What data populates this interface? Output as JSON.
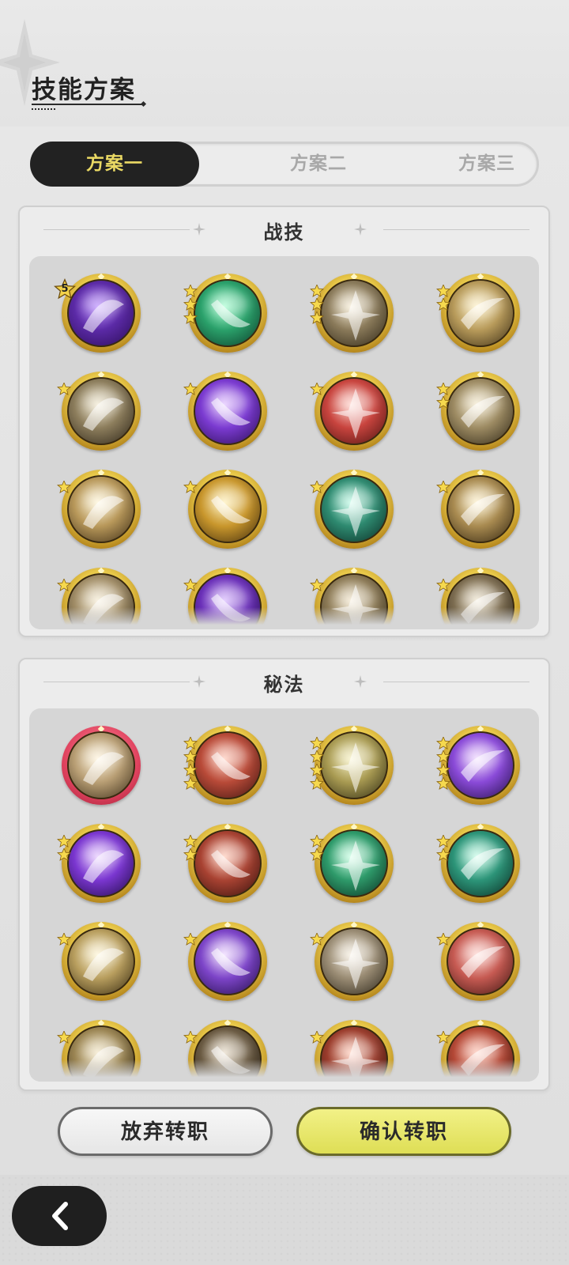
{
  "header": {
    "title": "技能方案"
  },
  "tabs": [
    {
      "label": "方案一",
      "active": true
    },
    {
      "label": "方案二",
      "active": false
    },
    {
      "label": "方案三",
      "active": false
    }
  ],
  "sections": [
    {
      "title": "战技",
      "skills": [
        {
          "name": "violet-heart-skill-icon",
          "colors": [
            "#b98cff",
            "#5b2aa6",
            "#2a0c55"
          ],
          "stars": 0,
          "level_badge": "5"
        },
        {
          "name": "green-arrows-skill-icon",
          "colors": [
            "#a8ffd2",
            "#2aa06a",
            "#0c3a28"
          ],
          "stars": 3
        },
        {
          "name": "swirl-slash-skill-icon",
          "colors": [
            "#f6ecd4",
            "#8a7a5a",
            "#2e2616"
          ],
          "stars": 3
        },
        {
          "name": "golden-blade-skill-icon",
          "colors": [
            "#fff2c8",
            "#b79a5a",
            "#3a2c14"
          ],
          "stars": 2
        },
        {
          "name": "wind-slash-skill-icon",
          "colors": [
            "#f2ead2",
            "#8c7d5c",
            "#2a2216"
          ],
          "stars": 1
        },
        {
          "name": "violet-orb-skill-icon",
          "colors": [
            "#e2c2ff",
            "#7a3ad0",
            "#2a0e52"
          ],
          "stars": 1
        },
        {
          "name": "red-warrior-skill-icon",
          "colors": [
            "#ffd0c8",
            "#c8443e",
            "#4a1210"
          ],
          "stars": 1
        },
        {
          "name": "sweeping-arm-skill-icon",
          "colors": [
            "#f6ecd0",
            "#9c8a62",
            "#2e2616"
          ],
          "stars": 2
        },
        {
          "name": "burst-skill-icon",
          "colors": [
            "#fff6d8",
            "#b8985a",
            "#3a2a14"
          ],
          "stars": 1
        },
        {
          "name": "golden-crescent-skill-icon",
          "colors": [
            "#fff0b8",
            "#c8962c",
            "#3e2a0c"
          ],
          "stars": 1
        },
        {
          "name": "teal-crescent-skill-icon",
          "colors": [
            "#bffbe6",
            "#2e8a70",
            "#0a2a22"
          ],
          "stars": 1
        },
        {
          "name": "lightning-slash-skill-icon",
          "colors": [
            "#fff2cc",
            "#a88a50",
            "#30230f"
          ],
          "stars": 1
        },
        {
          "name": "afterimage-skill-icon",
          "colors": [
            "#f6ecd4",
            "#a08c66",
            "#2e2618"
          ],
          "stars": 1
        },
        {
          "name": "violet-storm-skill-icon",
          "colors": [
            "#d8b8ff",
            "#6a30b8",
            "#1e0a40"
          ],
          "stars": 1
        },
        {
          "name": "crescent-kick-skill-icon",
          "colors": [
            "#f2e6cc",
            "#8c7a56",
            "#2a2214"
          ],
          "stars": 1
        },
        {
          "name": "spiral-blades-skill-icon",
          "colors": [
            "#f0e6d0",
            "#7c6c50",
            "#221c12"
          ],
          "stars": 1
        }
      ]
    },
    {
      "title": "秘法",
      "skills": [
        {
          "name": "maple-leaf-skill-icon",
          "colors": [
            "#fff4dc",
            "#b89e74",
            "#3a2c18"
          ],
          "stars": 0,
          "ring": "red"
        },
        {
          "name": "red-dragon-skill-icon",
          "colors": [
            "#ffc8b8",
            "#b84a38",
            "#3e1410"
          ],
          "stars": 4
        },
        {
          "name": "golden-guardian-skill-icon",
          "colors": [
            "#f6f0c0",
            "#a89a52",
            "#2e2a12"
          ],
          "stars": 4
        },
        {
          "name": "violet-silhouette-skill-icon",
          "colors": [
            "#f0d8ff",
            "#8a4ad8",
            "#24104a"
          ],
          "stars": 4
        },
        {
          "name": "violet-flame-skill-icon",
          "colors": [
            "#e6c8ff",
            "#7a36d0",
            "#200c44"
          ],
          "stars": 2
        },
        {
          "name": "red-armor-skill-icon",
          "colors": [
            "#ffcab8",
            "#a84232",
            "#34110c"
          ],
          "stars": 2
        },
        {
          "name": "green-heart-skill-icon",
          "colors": [
            "#c6ffe2",
            "#2e9a6a",
            "#0a2e20"
          ],
          "stars": 2
        },
        {
          "name": "green-heal-skill-icon",
          "colors": [
            "#c8ffea",
            "#2c9478",
            "#0a2c22"
          ],
          "stars": 2
        },
        {
          "name": "golden-eye-skill-icon",
          "colors": [
            "#fff6d6",
            "#b89e5e",
            "#34280f"
          ],
          "stars": 1
        },
        {
          "name": "violet-shield-skill-icon",
          "colors": [
            "#eed8ff",
            "#7c44c8",
            "#220e46"
          ],
          "stars": 1
        },
        {
          "name": "crystal-blade-skill-icon",
          "colors": [
            "#f6eee0",
            "#9a8c74",
            "#2a2418"
          ],
          "stars": 1
        },
        {
          "name": "red-sword-skill-icon",
          "colors": [
            "#ffd6d0",
            "#c65a52",
            "#3e1612"
          ],
          "stars": 1
        },
        {
          "name": "golden-horse-skill-icon",
          "colors": [
            "#f4e8c8",
            "#9a8452",
            "#2a2212"
          ],
          "stars": 1
        },
        {
          "name": "dark-totem-skill-icon",
          "colors": [
            "#e8dcc8",
            "#6a5a42",
            "#1e1810"
          ],
          "stars": 1
        },
        {
          "name": "red-hexagon-skill-icon",
          "colors": [
            "#ffcbb8",
            "#9a3c2c",
            "#2e100a"
          ],
          "stars": 1
        },
        {
          "name": "crimson-crack-skill-icon",
          "colors": [
            "#ffc6b6",
            "#b44836",
            "#38120c"
          ],
          "stars": 1
        }
      ]
    }
  ],
  "buttons": {
    "abandon_label": "放弃转职",
    "confirm_label": "确认转职"
  },
  "nav": {
    "back_icon": "chevron-left-icon"
  }
}
